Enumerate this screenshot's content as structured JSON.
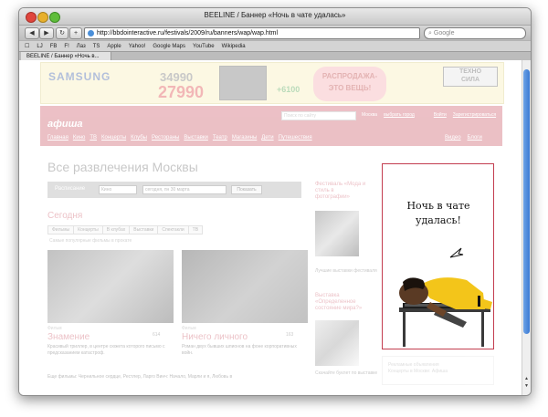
{
  "window": {
    "title": "BEELINE / Баннер «Ночь в чате удалась»"
  },
  "toolbar": {
    "back": "◀",
    "forward": "▶",
    "reload": "↻",
    "add": "+",
    "url": "http://bbdointeractive.ru/festivals/2009/ru/banners/wap/wap.html",
    "search_placeholder": "Google"
  },
  "bookmarks": [
    "LJ",
    "FB",
    "F!",
    "Лаз",
    "TS",
    "Apple",
    "Yahoo!",
    "Google Maps",
    "YouTube",
    "Wikipedia"
  ],
  "tab": {
    "label": "BEELINE / Баннер «Ночь в..."
  },
  "banner": {
    "brand": "SAMSUNG",
    "old_price": "34990",
    "new_price": "27990",
    "sale": "РАСПРОДАЖА-\nЭТО ВЕЩЬ!",
    "bonus": "+6100",
    "store": "ТЕХНО\nСИЛА"
  },
  "afisha": {
    "logo": "афиша",
    "search_placeholder": "Поиск по сайту",
    "city": "Москва",
    "choose_city": "выбрать город",
    "login": "Войти",
    "register": "Зарегистрироваться",
    "nav": [
      "Главная",
      "Кино",
      "ТВ",
      "Концерты",
      "Клубы",
      "Рестораны",
      "Выставки",
      "Театр",
      "Магазины",
      "Дети",
      "Путешествия"
    ],
    "right_nav": [
      "Видео",
      "Блоги"
    ]
  },
  "main": {
    "heading": "Все развлечения Москвы",
    "filter": {
      "label": "Расписание",
      "category": "Кино",
      "date": "сегодня, пн 30 марта",
      "show": "Показать"
    },
    "today": "Сегодня",
    "subtabs": [
      "Фильмы",
      "Концерты",
      "В клубах",
      "Выставки",
      "Спектакли",
      "ТВ"
    ],
    "subtitle": "Самые популярные фильмы в прокате",
    "films": [
      {
        "genre": "Фильм",
        "title": "Знамение",
        "rating": "614",
        "desc": "Красивый триллер, в центре сюжета которого письмо с предсказанием катастроф."
      },
      {
        "genre": "Фильм",
        "title": "Ничего личного",
        "rating": "163",
        "desc": "Роман двух бывших шпионов на фоне корпоративных войн."
      }
    ],
    "more": "Еще фильмы: Чернильное сердце, Рестлер, Ларго Винч: Начало, Марли и я, Любовь в"
  },
  "side": {
    "feature_title": "Фестиваль «Мода и стиль в фотографии»",
    "feature_caption": "Лучшие выставки фестиваля",
    "feature2_title": "Выставка «Определенное состояние мира?»",
    "feature2_caption": "Скачайте буклет по выставке"
  },
  "ad": {
    "text": "Ночь в чате удалась!"
  },
  "ad_below": {
    "label": "Рекламные объявления",
    "text": "Концерты в Москве: Афиша"
  }
}
